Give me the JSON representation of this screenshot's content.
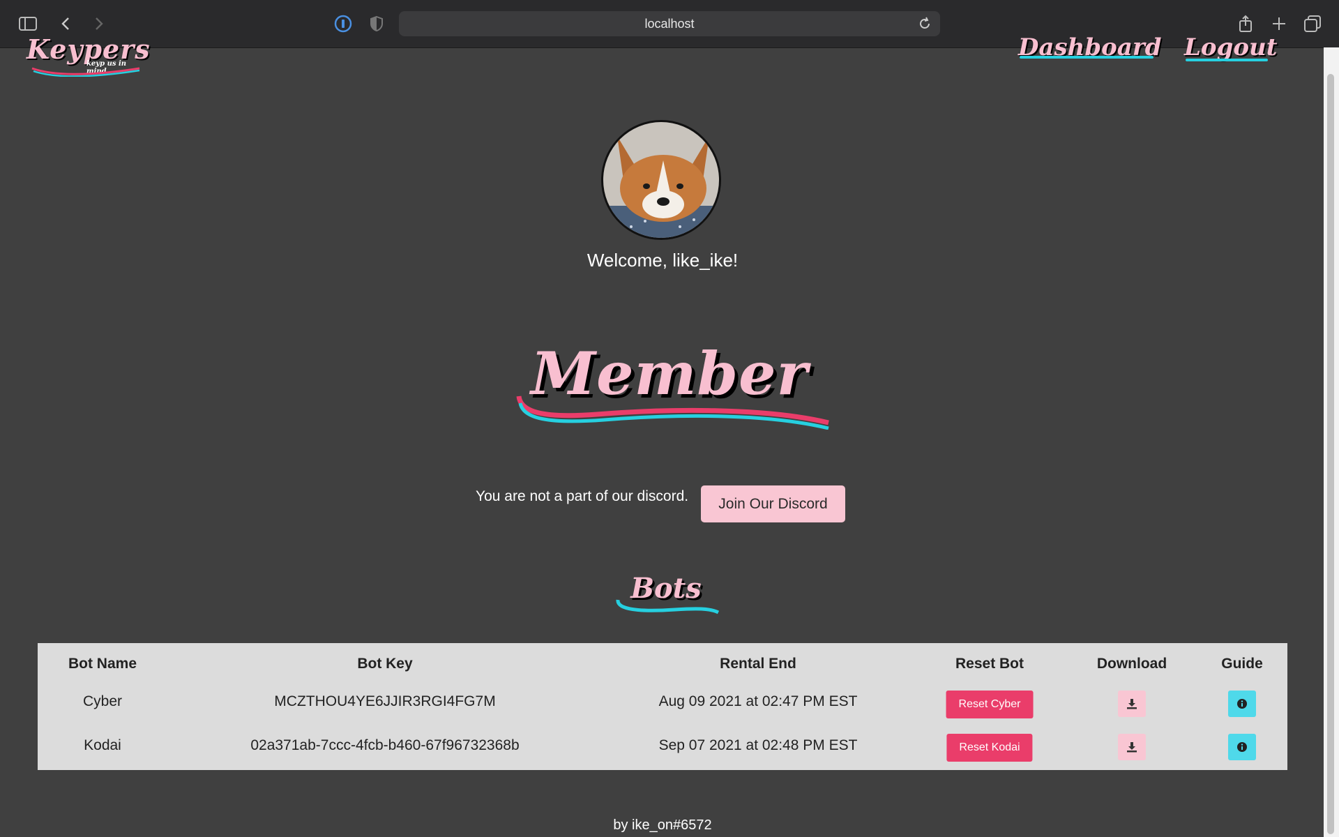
{
  "browser": {
    "url": "localhost",
    "icons": [
      "sidebar-icon",
      "back-icon",
      "forward-icon",
      "password-manager-icon",
      "shield-icon",
      "reload-icon",
      "share-icon",
      "new-tab-icon",
      "tabs-overview-icon"
    ]
  },
  "header": {
    "logo_text": "Keypers",
    "logo_tagline": "keyp us in mind",
    "nav": {
      "dashboard": "Dashboard",
      "logout": "Logout"
    }
  },
  "profile": {
    "welcome": "Welcome, like_ike!"
  },
  "membership": {
    "title": "Member",
    "discord_message": "You are not a part of our discord.",
    "discord_button": "Join Our Discord"
  },
  "bots": {
    "title": "Bots",
    "columns": [
      "Bot Name",
      "Bot Key",
      "Rental End",
      "Reset Bot",
      "Download",
      "Guide"
    ],
    "rows": [
      {
        "name": "Cyber",
        "key": "MCZTHOU4YE6JJIR3RGI4FG7M",
        "rental_end": "Aug 09 2021 at 02:47 PM EST",
        "reset_label": "Reset Cyber"
      },
      {
        "name": "Kodai",
        "key": "02a371ab-7ccc-4fcb-b460-67f96732368b",
        "rental_end": "Sep 07 2021 at 02:48 PM EST",
        "reset_label": "Reset Kodai"
      }
    ]
  },
  "footer": {
    "credit": "by ike_on#6572"
  },
  "colors": {
    "page_bg": "#404040",
    "brand_pink": "#f8bfd0",
    "accent_red": "#ea3d6a",
    "accent_cyan": "#26d0e0",
    "table_bg": "#dcdcdc"
  }
}
